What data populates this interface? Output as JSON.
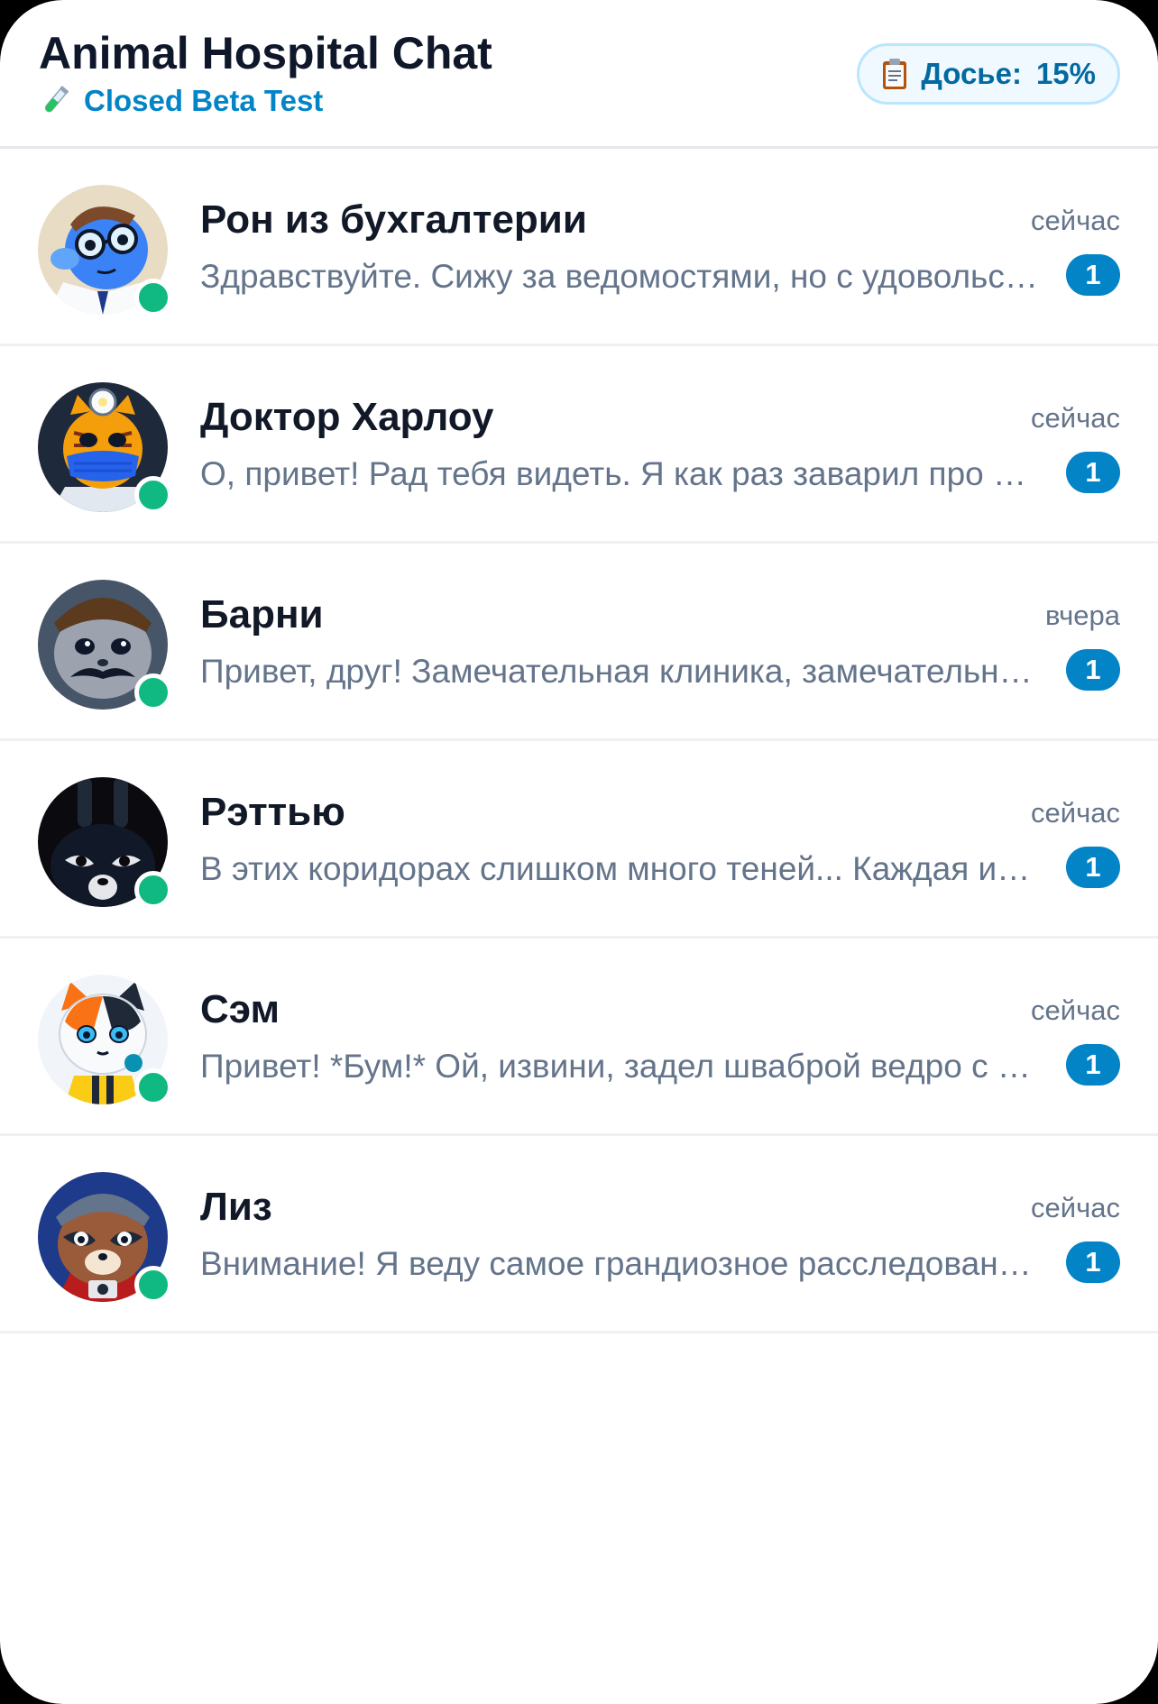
{
  "header": {
    "title": "Animal Hospital Chat",
    "subtitle": "Closed Beta Test",
    "subtitle_icon": "test-tube-icon",
    "dossier": {
      "icon": "clipboard-icon",
      "label": "Досье:",
      "value": "15%",
      "progress_percent": 15
    }
  },
  "colors": {
    "accent": "#0284c7",
    "online": "#10b981",
    "title": "#0f172a",
    "muted": "#64748b"
  },
  "chats": [
    {
      "name": "Рон из бухгалтерии",
      "time": "сейчас",
      "preview": "Здравствуйте. Сижу за ведомостями, но с удовольствием отвлекусь на разговор",
      "unread": "1",
      "avatar": "blue-cat-glasses-avatar",
      "online": true
    },
    {
      "name": "Доктор Харлоу",
      "time": "сейчас",
      "preview": "О, привет! Рад тебя видеть. Я как раз заварил про запас свежий чай",
      "unread": "1",
      "avatar": "tiger-doctor-mask-avatar",
      "online": true
    },
    {
      "name": "Барни",
      "time": "вчера",
      "preview": "Привет, друг! Замечательная клиника, замечательные люди",
      "unread": "1",
      "avatar": "grey-cat-mustache-avatar",
      "online": true
    },
    {
      "name": "Рэттью",
      "time": "сейчас",
      "preview": "В этих коридорах слишком много теней... Каждая из них что-то скрывает",
      "unread": "1",
      "avatar": "black-rabbit-avatar",
      "online": true
    },
    {
      "name": "Сэм",
      "time": "сейчас",
      "preview": "Привет! *Бум!* Ой, извини, задел шваброй ведро с водой",
      "unread": "1",
      "avatar": "calico-cat-janitor-avatar",
      "online": true
    },
    {
      "name": "Лиз",
      "time": "сейчас",
      "preview": "Внимание! Я веду самое грандиозное расследование в этой клинике",
      "unread": "1",
      "avatar": "raccoon-reporter-avatar",
      "online": true
    }
  ]
}
